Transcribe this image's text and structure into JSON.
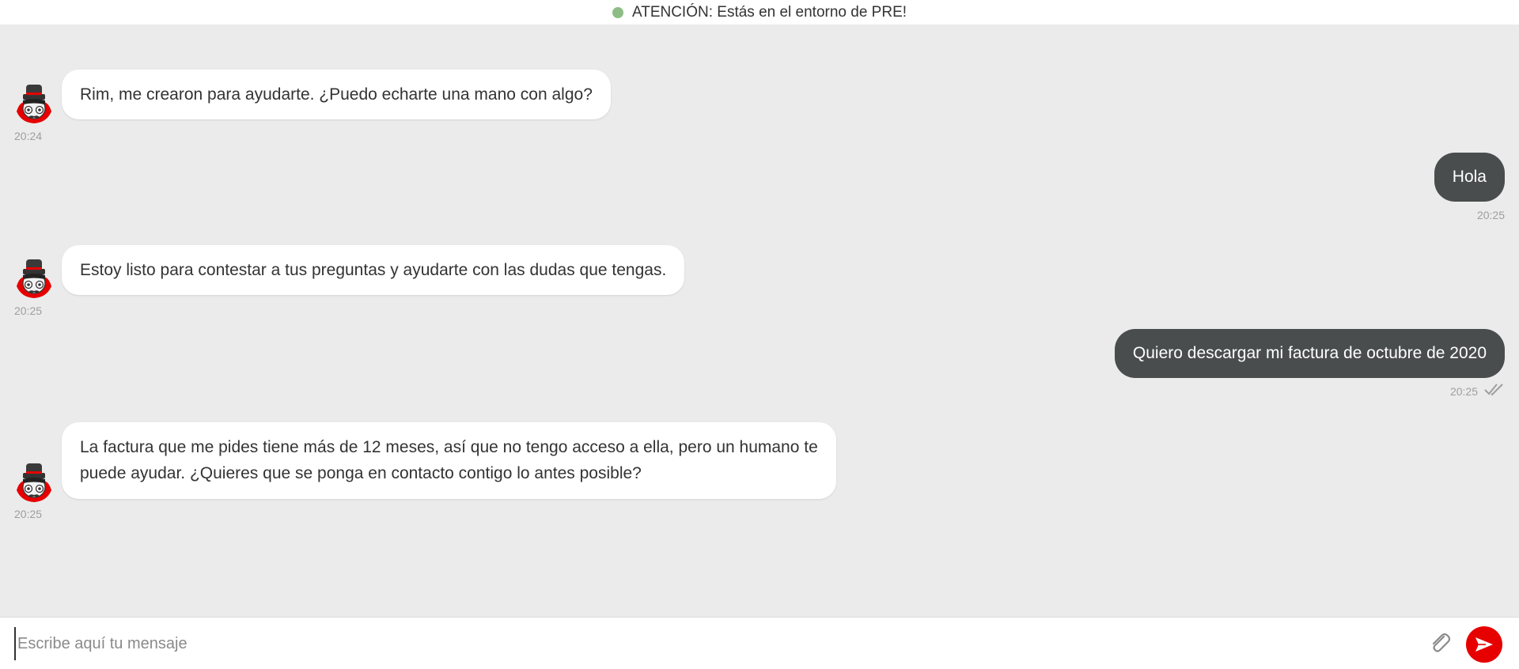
{
  "banner": {
    "text": "ATENCIÓN: Estás en el entorno de PRE!",
    "status_color": "#8dbd84"
  },
  "messages": [
    {
      "sender": "bot",
      "text_lines": [
        "Rim, me crearon para ayudarte. ¿Puedo echarte una mano con algo?"
      ],
      "time": "20:24"
    },
    {
      "sender": "user",
      "text_lines": [
        "Hola"
      ],
      "time": "20:25"
    },
    {
      "sender": "bot",
      "text_lines": [
        "Estoy listo para contestar a tus preguntas y ayudarte con las dudas que tengas."
      ],
      "time": "20:25"
    },
    {
      "sender": "user",
      "text_lines": [
        "Quiero descargar mi factura de octubre de 2020"
      ],
      "time": "20:25",
      "read_receipt": "double-check-icon"
    },
    {
      "sender": "bot",
      "text_lines": [
        "La factura que me pides tiene más de 12 meses, así que no tengo acceso a ella, pero un humano te",
        "puede ayudar. ¿Quieres que se ponga en contacto contigo lo antes posible?"
      ],
      "time": "20:25"
    }
  ],
  "composer": {
    "placeholder": "Escribe aquí tu mensaje",
    "value": "",
    "attach_icon": "paperclip-icon",
    "send_icon": "send-icon",
    "send_color": "#e60000"
  },
  "colors": {
    "background": "#ebebeb",
    "bot_bubble": "#ffffff",
    "user_bubble": "#4a4d4e"
  },
  "avatar_icon": "bot-avatar-icon"
}
